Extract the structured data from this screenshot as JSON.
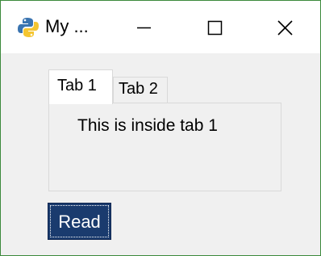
{
  "window": {
    "title": "My ...",
    "app_icon": "python-icon",
    "controls": {
      "minimize": "minimize-icon",
      "maximize": "maximize-icon",
      "close": "close-icon"
    }
  },
  "tabs": [
    {
      "label": "Tab 1",
      "selected": true
    },
    {
      "label": "Tab 2",
      "selected": false
    }
  ],
  "panel": {
    "text": "This is inside tab 1"
  },
  "read_button": {
    "label": "Read"
  },
  "colors": {
    "window_border": "#3c8a3c",
    "button_bg": "#1a3b6e",
    "client_bg": "#f0f0f0"
  }
}
